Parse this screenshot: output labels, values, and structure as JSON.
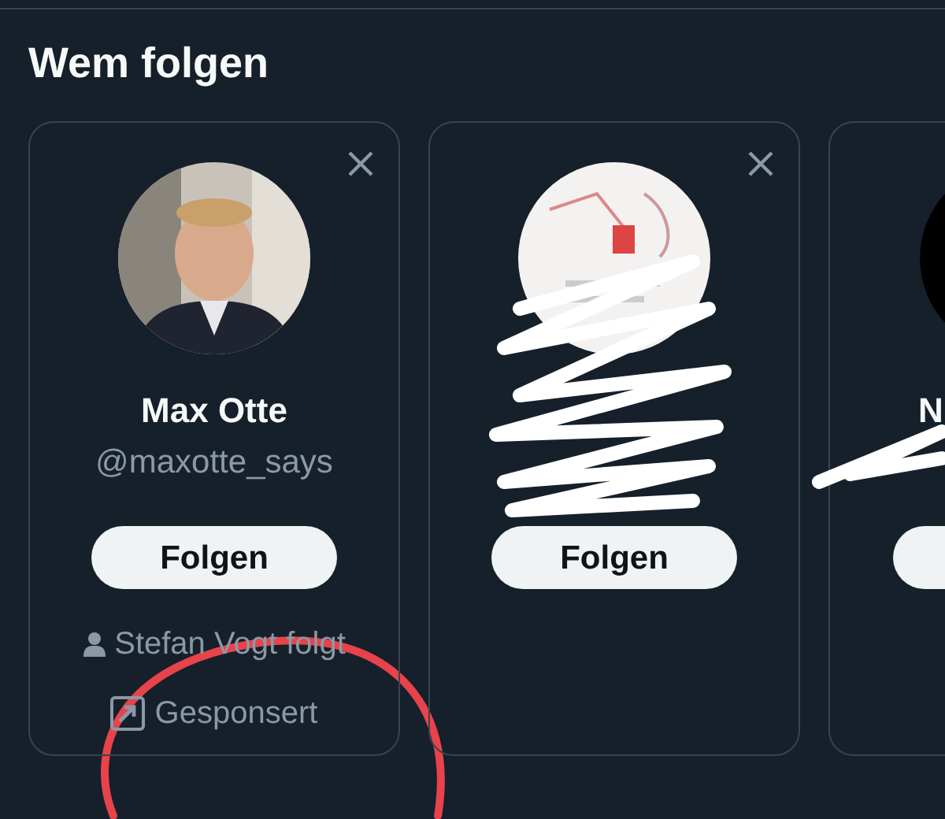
{
  "title": "Wem folgen",
  "cards": [
    {
      "name": "Max Otte",
      "handle": "@maxotte_says",
      "button": "Folgen",
      "social": "Stefan Vogt folgt",
      "promoted": "Gesponsert",
      "dismissable": true,
      "scribbled": false
    },
    {
      "button": "Folgen",
      "dismissable": true,
      "scribbled": true
    },
    {
      "avatar": {
        "kind": "plain"
      },
      "name": "N",
      "dismissable": false,
      "scribbled": true
    }
  ],
  "annotation": {
    "kind": "circle"
  }
}
